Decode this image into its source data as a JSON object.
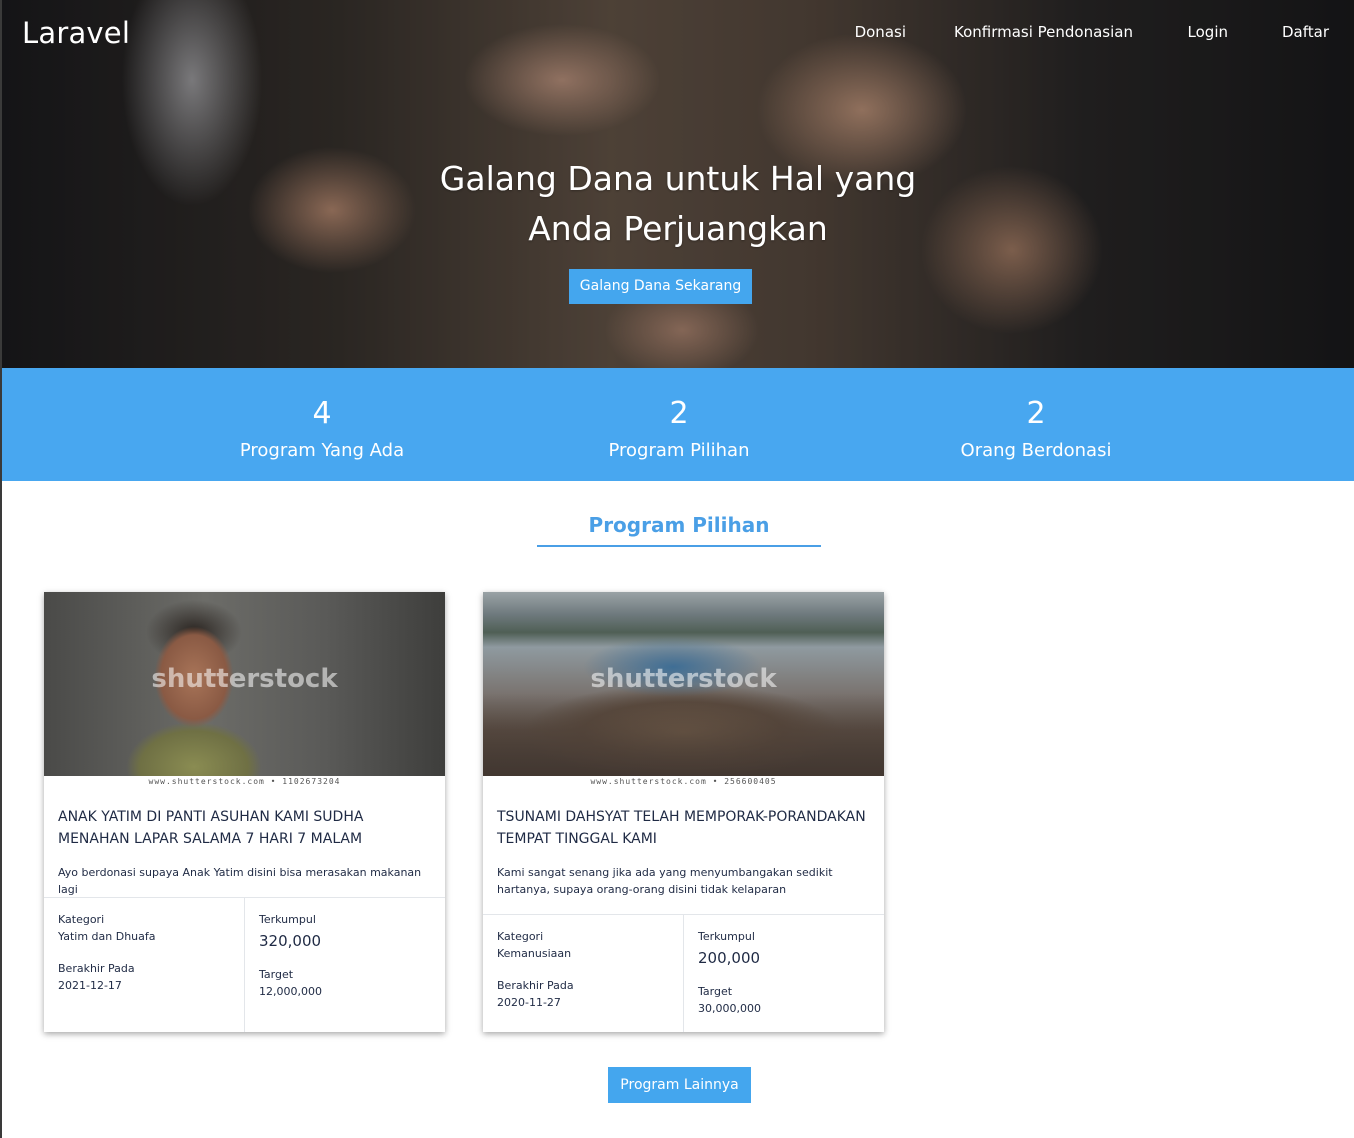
{
  "brand": "Laravel",
  "nav": {
    "items": [
      {
        "label": "Donasi"
      },
      {
        "label": "Konfirmasi Pendonasian"
      },
      {
        "label": "Login"
      },
      {
        "label": "Daftar"
      }
    ]
  },
  "hero": {
    "title_line1": "Galang Dana untuk Hal yang",
    "title_line2": "Anda Perjuangkan",
    "button_label": "Galang Dana Sekarang"
  },
  "stats": [
    {
      "value": "4",
      "label": "Program Yang Ada"
    },
    {
      "value": "2",
      "label": "Program Pilihan"
    },
    {
      "value": "2",
      "label": "Orang Berdonasi"
    }
  ],
  "section": {
    "title": "Program Pilihan"
  },
  "cards": [
    {
      "image_watermark": "shutterstock",
      "image_credit": "www.shutterstock.com • 1102673204",
      "title": "ANAK YATIM DI PANTI ASUHAN KAMI SUDHA MENAHAN LAPAR SALAMA 7 HARI 7 MALAM",
      "description": "Ayo berdonasi supaya Anak Yatim disini bisa merasakan makanan lagi",
      "category_label": "Kategori",
      "category_value": "Yatim dan Dhuafa",
      "end_label": "Berakhir Pada",
      "end_value": "2021-12-17",
      "collected_label": "Terkumpul",
      "collected_value": "320,000",
      "target_label": "Target",
      "target_value": "12,000,000"
    },
    {
      "image_watermark": "shutterstock",
      "image_credit": "www.shutterstock.com • 256600405",
      "title": "TSUNAMI DAHSYAT TELAH MEMPORAK-PORANDAKAN TEMPAT TINGGAL KAMI",
      "description": "Kami sangat senang jika ada yang menyumbangakan sedikit hartanya, supaya orang-orang disini tidak kelaparan",
      "category_label": "Kategori",
      "category_value": "Kemanusiaan",
      "end_label": "Berakhir Pada",
      "end_value": "2020-11-27",
      "collected_label": "Terkumpul",
      "collected_value": "200,000",
      "target_label": "Target",
      "target_value": "30,000,000"
    }
  ],
  "more_button_label": "Program Lainnya",
  "colors": {
    "accent": "#48a7f0",
    "section_title": "#4a9fe6",
    "text": "#1f2a44"
  }
}
